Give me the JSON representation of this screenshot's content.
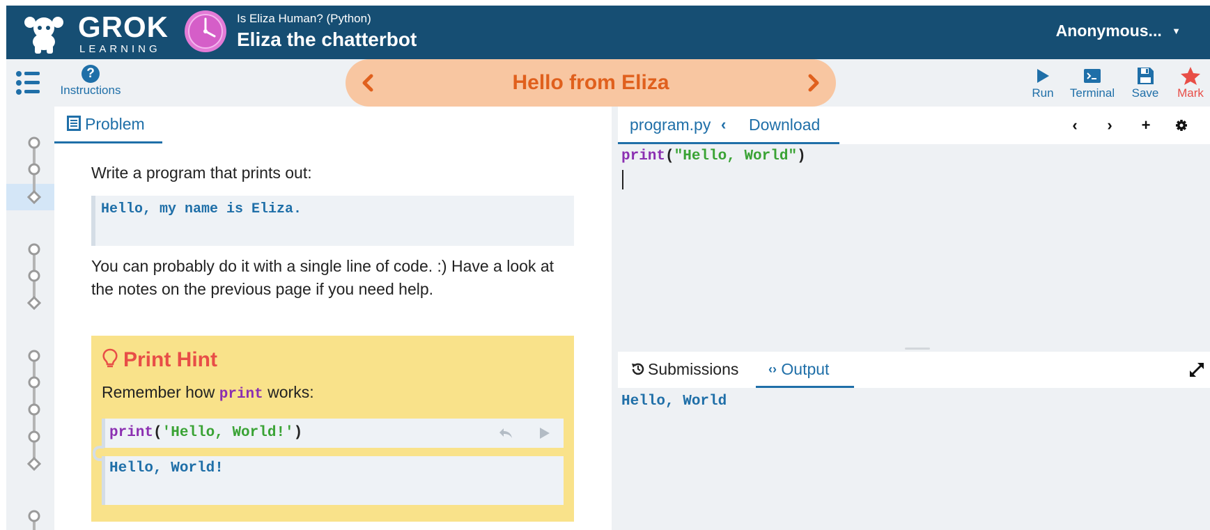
{
  "header": {
    "logo_word": "GROK",
    "logo_sub": "LEARNING",
    "course_subtitle": "Is Eliza Human? (Python)",
    "course_title": "Eliza the chatterbot",
    "user_name": "Anonymous...",
    "icons": [
      "grok-mascot-icon",
      "clock-icon",
      "caret-down-icon"
    ]
  },
  "toolbar": {
    "instructions_label": "Instructions",
    "slide_title": "Hello from Eliza",
    "tools": [
      {
        "label": "Run",
        "icon": "play-icon"
      },
      {
        "label": "Terminal",
        "icon": "terminal-icon"
      },
      {
        "label": "Save",
        "icon": "save-icon"
      },
      {
        "label": "Mark",
        "icon": "star-icon"
      }
    ]
  },
  "problem": {
    "tab_label": "Problem",
    "intro": "Write a program that prints out:",
    "expected_output": "Hello, my name is Eliza.",
    "body": "You can probably do it with a single line of code. :) Have a look at the notes on the previous page if you need help.",
    "hint": {
      "title": "Print Hint",
      "text_before": "Remember how ",
      "text_code": "print",
      "text_after": " works:",
      "code_fn": "print",
      "code_open": "(",
      "code_str": "'Hello, World!'",
      "code_close": ")",
      "output": "Hello, World!"
    }
  },
  "editor": {
    "file_name": "program.py",
    "download_label": "Download",
    "code_fn": "print",
    "code_open": "(",
    "code_str": "\"Hello, World\"",
    "code_close": ")"
  },
  "output_panel": {
    "submissions_label": "Submissions",
    "output_label": "Output",
    "output_text": "Hello, World"
  },
  "colors": {
    "header_bg": "#164e73",
    "accent_blue": "#1f6fa8",
    "slide_bg": "#f8c6a1",
    "slide_text": "#e0601d",
    "hint_bg": "#f9e28a",
    "hint_title": "#e84e47",
    "keyword": "#8b2fb1",
    "string": "#3aa335",
    "mark_star": "#e84e47"
  }
}
